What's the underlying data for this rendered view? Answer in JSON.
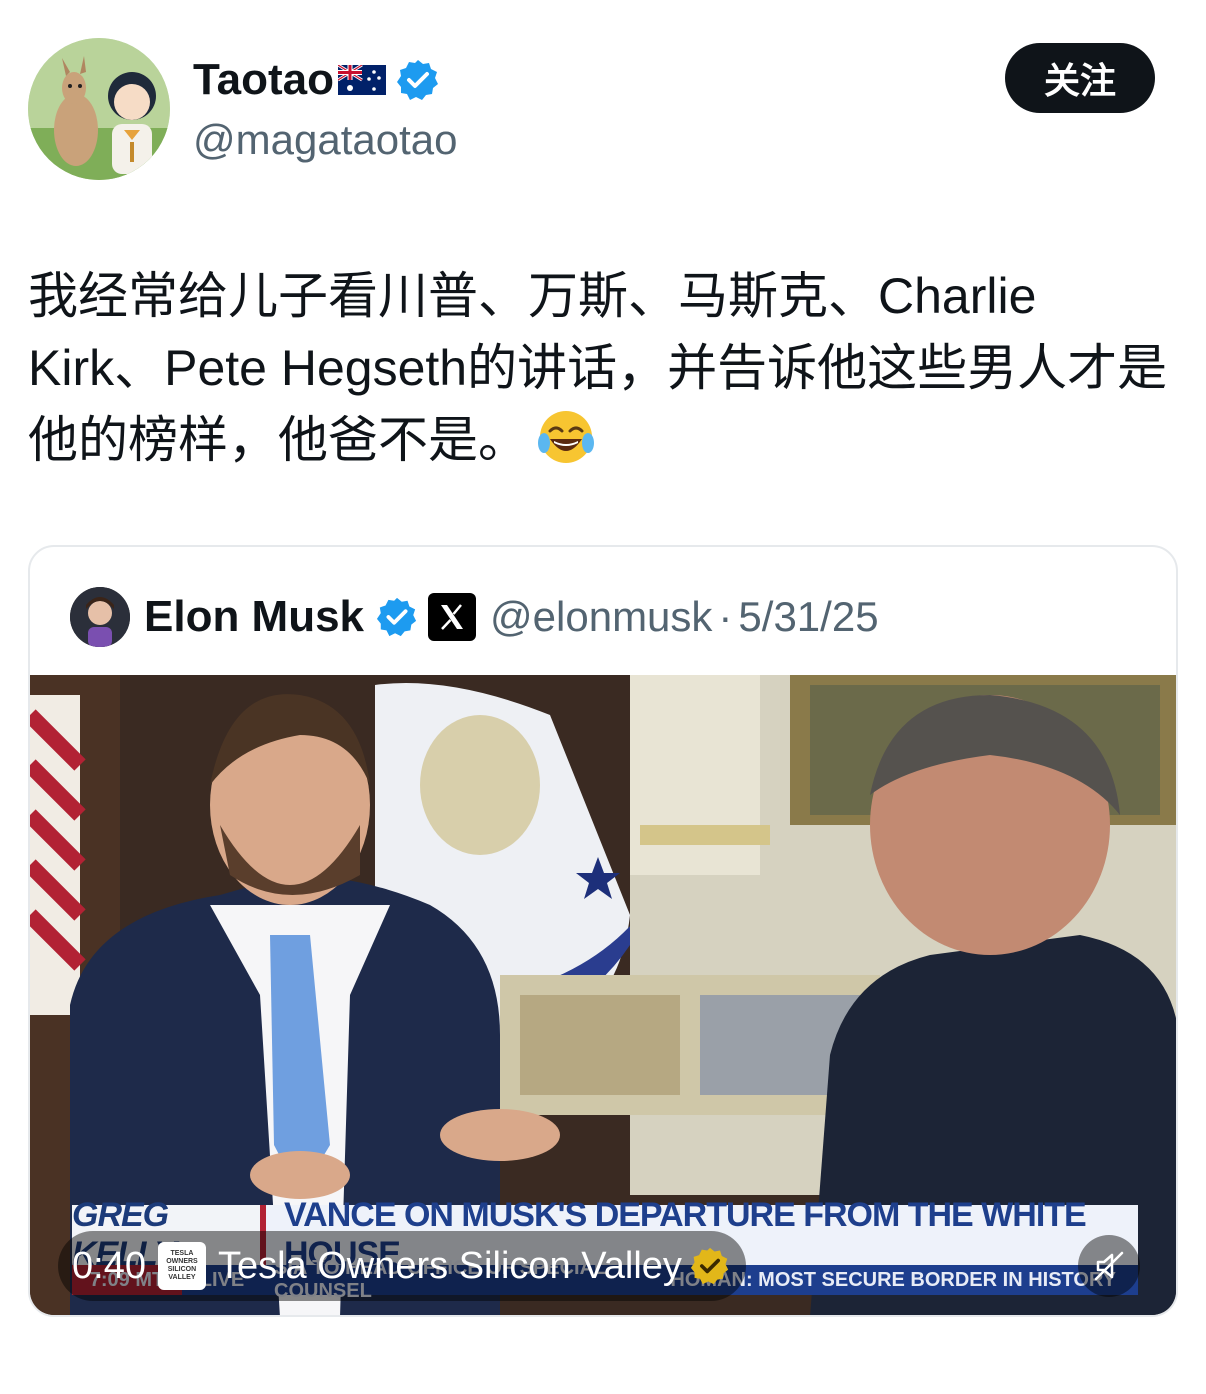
{
  "author": {
    "display_name": "Taotao",
    "flag": "australia-flag-icon",
    "handle": "@magataotao",
    "verified": true
  },
  "follow_button": {
    "label": "关注"
  },
  "tweet": {
    "text": "我经常给儿子看川普、万斯、马斯克、Charlie Kirk、Pete Hegseth的讲话，并告诉他这些男人才是他的榜样，他爸不是。",
    "emoji": "laughing-tears-emoji"
  },
  "quote": {
    "display_name": "Elon Musk",
    "handle": "@elonmusk",
    "separator": "·",
    "date": "5/31/25",
    "media": {
      "duration": "0:40",
      "source_name": "Tesla Owners Silicon Valley",
      "source_logo_text": [
        "TESLA",
        "OWNERS",
        "SILICON",
        "VALLEY"
      ],
      "chyron": {
        "show": "GREG KELLY",
        "headline": "VANCE ON MUSK'S DEPARTURE FROM THE WHITE HOUSE",
        "time": "7:09 MT",
        "live": "LIVE",
        "ticker_left": "SIA TO HEAD OFFICE OF SPECIAL COUNSEL",
        "ticker_right": "HOMAN: MOST SECURE BORDER IN HISTORY"
      }
    }
  },
  "colors": {
    "verified_blue": "#1d9bf0",
    "gold_badge": "#e2b719",
    "text_primary": "#0f1419",
    "text_secondary": "#536471"
  }
}
